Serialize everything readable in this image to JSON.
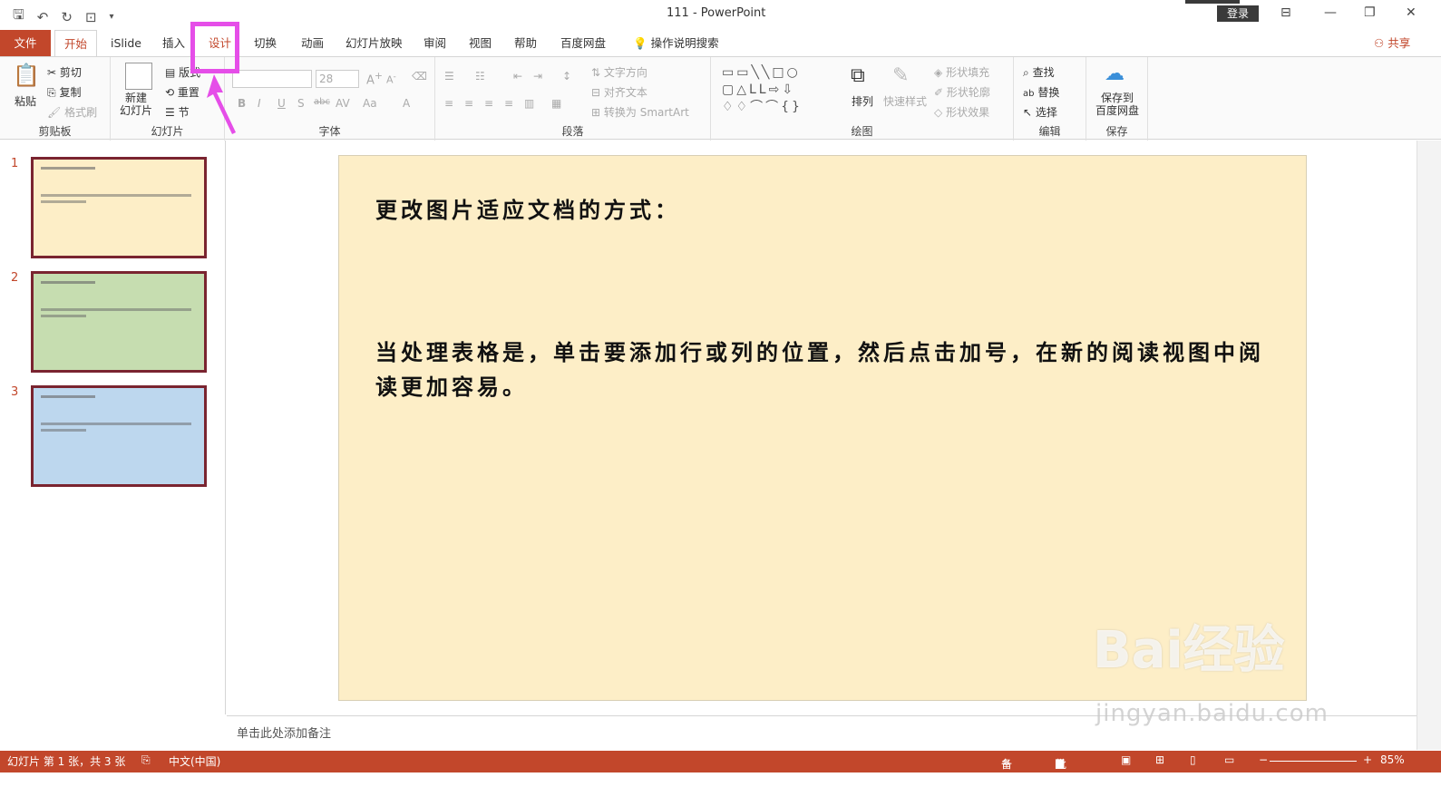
{
  "window": {
    "title": "111  -  PowerPoint",
    "login_label": "登录"
  },
  "tabs": [
    {
      "label": "文件"
    },
    {
      "label": "开始"
    },
    {
      "label": "iSlide"
    },
    {
      "label": "插入"
    },
    {
      "label": "设计"
    },
    {
      "label": "切换"
    },
    {
      "label": "动画"
    },
    {
      "label": "幻灯片放映"
    },
    {
      "label": "审阅"
    },
    {
      "label": "视图"
    },
    {
      "label": "帮助"
    },
    {
      "label": "百度网盘"
    },
    {
      "label": "操作说明搜索"
    }
  ],
  "share_label": "共享",
  "ribbon": {
    "clipboard": {
      "paste": "粘贴",
      "cut": "剪切",
      "copy": "复制",
      "format_painter": "格式刷",
      "label": "剪贴板"
    },
    "slides": {
      "new_slide": "新建\n幻灯片",
      "layout": "版式",
      "reset": "重置",
      "section": "节",
      "label": "幻灯片"
    },
    "font": {
      "font_size": "28",
      "label": "字体"
    },
    "paragraph": {
      "text_direction": "文字方向",
      "align_text": "对齐文本",
      "convert_smartart": "转换为 SmartArt",
      "label": "段落"
    },
    "drawing": {
      "arrange": "排列",
      "quick_styles": "快速样式",
      "shape_fill": "形状填充",
      "shape_outline": "形状轮廓",
      "shape_effects": "形状效果",
      "label": "绘图"
    },
    "editing": {
      "find": "查找",
      "replace": "替换",
      "select": "选择",
      "label": "编辑"
    },
    "save": {
      "save_baidu": "保存到\n百度网盘",
      "label": "保存"
    }
  },
  "slides": [
    {
      "number": "1",
      "bg": "#fdeec7"
    },
    {
      "number": "2",
      "bg": "#c6ddb0"
    },
    {
      "number": "3",
      "bg": "#bdd7ee"
    }
  ],
  "slide": {
    "title": "更改图片适应文档的方式：",
    "body": "当处理表格是，单击要添加行或列的位置，然后点击加号，在新的阅读视图中阅读更加容易。"
  },
  "notes_placeholder": "单击此处添加备注",
  "status": {
    "slide_info": "幻灯片 第 1 张，共 3 张",
    "language": "中文(中国)",
    "notes": "备注",
    "comments": "批注",
    "zoom": "85%"
  },
  "watermark": {
    "brand": "Bai经验",
    "url": "jingyan.baidu.com"
  },
  "colors": {
    "accent": "#c2472b",
    "highlight": "#e54ee8"
  }
}
